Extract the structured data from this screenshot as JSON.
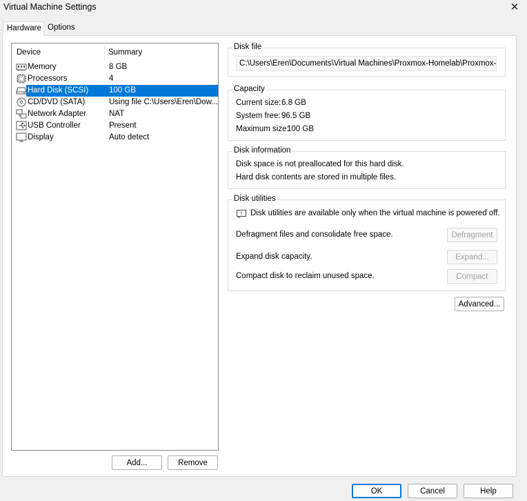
{
  "window": {
    "title": "Virtual Machine Settings",
    "close_glyph": "✕"
  },
  "tabs": [
    {
      "label": "Hardware",
      "active": true
    },
    {
      "label": "Options",
      "active": false
    }
  ],
  "device_list": {
    "columns": {
      "device": "Device",
      "summary": "Summary"
    },
    "rows": [
      {
        "name": "Memory",
        "summary": "8 GB",
        "icon": "memory-icon"
      },
      {
        "name": "Processors",
        "summary": "4",
        "icon": "processor-icon"
      },
      {
        "name": "Hard Disk (SCSI)",
        "summary": "100 GB",
        "icon": "hard-disk-icon",
        "selected": true
      },
      {
        "name": "CD/DVD (SATA)",
        "summary": "Using file C:\\Users\\Eren\\Dow...",
        "icon": "cd-dvd-icon"
      },
      {
        "name": "Network Adapter",
        "summary": "NAT",
        "icon": "network-adapter-icon"
      },
      {
        "name": "USB Controller",
        "summary": "Present",
        "icon": "usb-controller-icon"
      },
      {
        "name": "Display",
        "summary": "Auto detect",
        "icon": "display-icon"
      }
    ],
    "add_label": "Add...",
    "remove_label": "Remove"
  },
  "disk_file": {
    "group_label": "Disk file",
    "path": "C:\\Users\\Eren\\Documents\\Virtual Machines\\Proxmox-Homelab\\Proxmox-Homelab"
  },
  "capacity": {
    "group_label": "Capacity",
    "current_size": {
      "label": "Current size:",
      "value": "6.8 GB"
    },
    "system_free": {
      "label": "System free:",
      "value": "96.5 GB"
    },
    "maximum_size": {
      "label": "Maximum size:",
      "value": "100 GB"
    }
  },
  "disk_information": {
    "group_label": "Disk information",
    "line1": "Disk space is not preallocated for this hard disk.",
    "line2": "Hard disk contents are stored in multiple files."
  },
  "disk_utilities": {
    "group_label": "Disk utilities",
    "notice": "Disk utilities are available only when the virtual machine is powered off.",
    "defragment_text": "Defragment files and consolidate free space.",
    "defragment_label": "Defragment",
    "expand_text": "Expand disk capacity.",
    "expand_label": "Expand...",
    "compact_text": "Compact disk to reclaim unused space.",
    "compact_label": "Compact"
  },
  "advanced_label": "Advanced...",
  "footer": {
    "ok_label": "OK",
    "cancel_label": "Cancel",
    "help_label": "Help"
  },
  "colors": {
    "selection": "#0078d7",
    "panel_bg": "#ffffff",
    "window_bg": "#f0f0f0"
  }
}
